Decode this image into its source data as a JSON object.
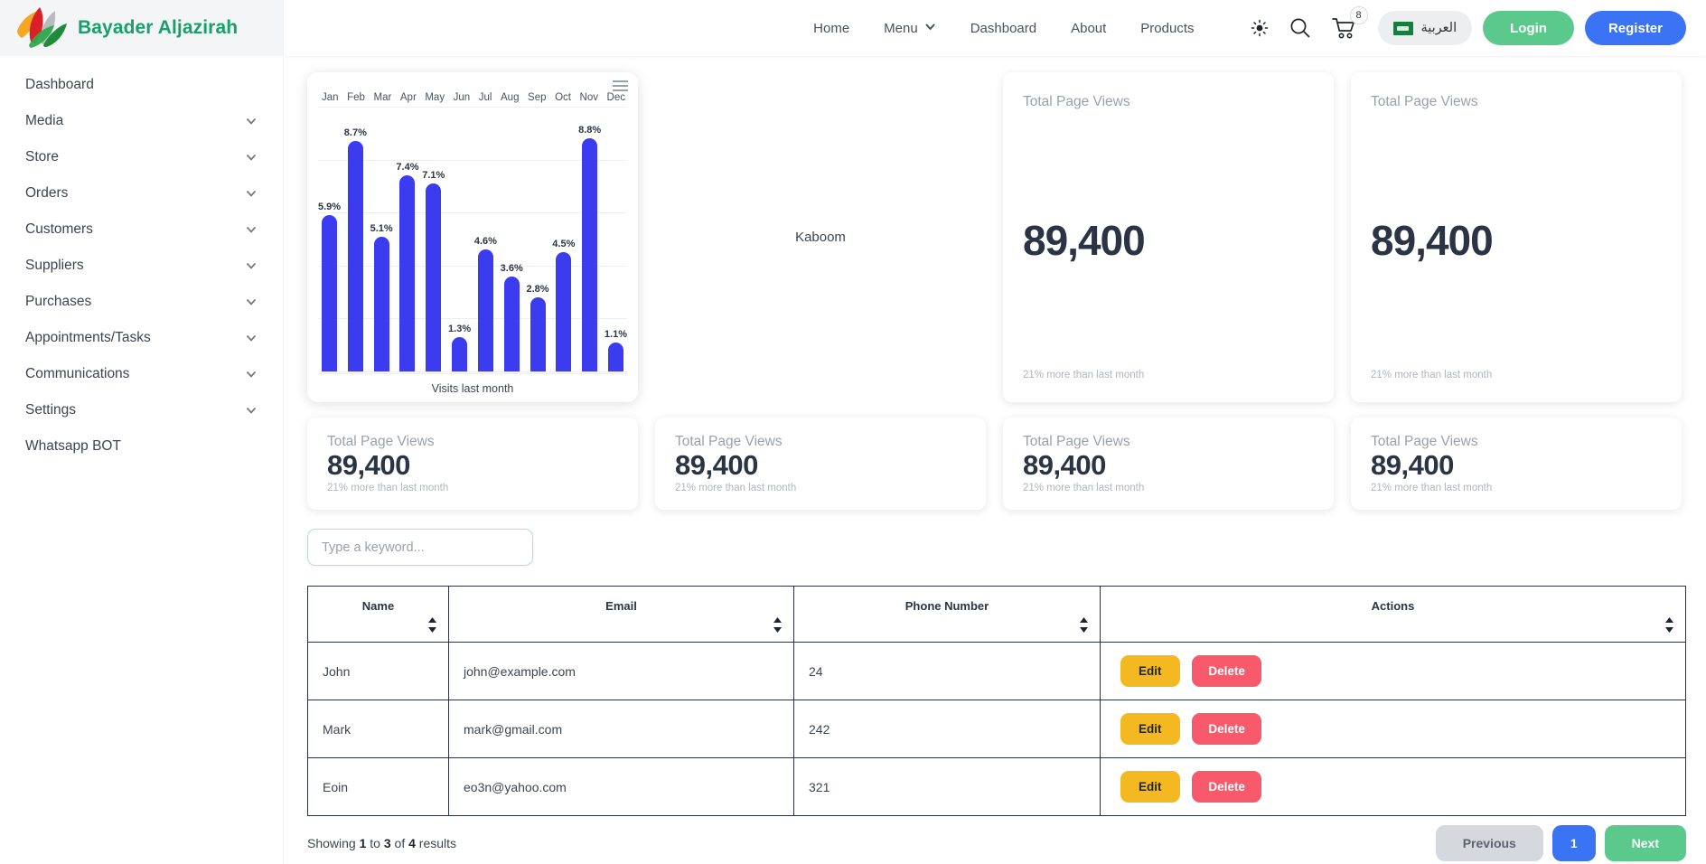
{
  "brand": {
    "name": "Bayader Aljazirah",
    "logo_icon": "leaf-logo-icon"
  },
  "sidebar": {
    "items": [
      {
        "label": "Dashboard",
        "expandable": false
      },
      {
        "label": "Media",
        "expandable": true
      },
      {
        "label": "Store",
        "expandable": true
      },
      {
        "label": "Orders",
        "expandable": true
      },
      {
        "label": "Customers",
        "expandable": true
      },
      {
        "label": "Suppliers",
        "expandable": true
      },
      {
        "label": "Purchases",
        "expandable": true
      },
      {
        "label": "Appointments/Tasks",
        "expandable": true
      },
      {
        "label": "Communications",
        "expandable": true
      },
      {
        "label": "Settings",
        "expandable": true
      },
      {
        "label": "Whatsapp BOT",
        "expandable": false
      }
    ]
  },
  "header": {
    "nav": [
      {
        "label": "Home",
        "has_caret": false
      },
      {
        "label": "Menu",
        "has_caret": true
      },
      {
        "label": "Dashboard",
        "has_caret": false
      },
      {
        "label": "About",
        "has_caret": false
      },
      {
        "label": "Products",
        "has_caret": false
      }
    ],
    "theme_icon": "sun-icon",
    "search_icon": "search-icon",
    "cart_icon": "cart-icon",
    "cart_count": "8",
    "language": {
      "label": "العربية",
      "flag_icon": "saudi-flag-icon"
    },
    "login_label": "Login",
    "register_label": "Register",
    "colors": {
      "login": "#5cc98c",
      "register": "#3b73f5",
      "brand": "#18a06a"
    }
  },
  "main": {
    "kaboom_text": "Kaboom",
    "menu_icon": "hamburger-menu-icon",
    "big_cards": [
      {
        "title": "Total Page Views",
        "value": "89,400",
        "sub": "21% more than last month"
      },
      {
        "title": "Total Page Views",
        "value": "89,400",
        "sub": "21% more than last month"
      }
    ],
    "stat_cards": [
      {
        "title": "Total Page Views",
        "value": "89,400",
        "sub": "21% more than last month"
      },
      {
        "title": "Total Page Views",
        "value": "89,400",
        "sub": "21% more than last month"
      },
      {
        "title": "Total Page Views",
        "value": "89,400",
        "sub": "21% more than last month"
      },
      {
        "title": "Total Page Views",
        "value": "89,400",
        "sub": "21% more than last month"
      }
    ],
    "search": {
      "placeholder": "Type a keyword...",
      "value": ""
    },
    "table": {
      "columns": [
        {
          "label": "Name",
          "sortable": true
        },
        {
          "label": "Email",
          "sortable": true
        },
        {
          "label": "Phone Number",
          "sortable": true
        },
        {
          "label": "Actions",
          "sortable": true
        }
      ],
      "rows": [
        {
          "name": "John",
          "email": "john@example.com",
          "phone": "24",
          "edit": "Edit",
          "delete": "Delete"
        },
        {
          "name": "Mark",
          "email": "mark@gmail.com",
          "phone": "242",
          "edit": "Edit",
          "delete": "Delete"
        },
        {
          "name": "Eoin",
          "email": "eo3n@yahoo.com",
          "phone": "321",
          "edit": "Edit",
          "delete": "Delete"
        }
      ],
      "showing": {
        "prefix": "Showing ",
        "from": "1",
        "mid1": " to ",
        "to": "3",
        "mid2": " of ",
        "total": "4",
        "suffix": " results"
      },
      "pager": {
        "prev": "Previous",
        "current": "1",
        "next": "Next"
      }
    }
  },
  "chart_data": {
    "type": "bar",
    "title": "",
    "footer_label": "Visits last month",
    "categories": [
      "Jan",
      "Feb",
      "Mar",
      "Apr",
      "May",
      "Jun",
      "Jul",
      "Aug",
      "Sep",
      "Oct",
      "Nov",
      "Dec"
    ],
    "values": [
      5.9,
      8.7,
      5.1,
      7.4,
      7.1,
      1.3,
      4.6,
      3.6,
      2.8,
      4.5,
      8.8,
      1.1
    ],
    "data_labels": [
      "5.9%",
      "8.7%",
      "5.1%",
      "7.4%",
      "7.1%",
      "1.3%",
      "4.6%",
      "3.6%",
      "2.8%",
      "4.5%",
      "8.8%",
      "1.1%"
    ],
    "xlabel": "",
    "ylabel": "",
    "ylim": [
      0,
      10
    ],
    "grid": true,
    "legend": false,
    "bar_color": "#3b3bf0"
  }
}
